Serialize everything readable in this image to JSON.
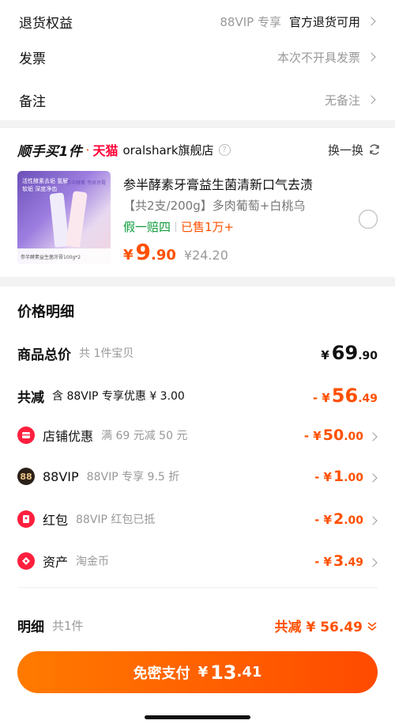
{
  "settings": {
    "refund": {
      "label": "退货权益",
      "value": "88VIP 专享",
      "value2": "官方退货可用"
    },
    "invoice": {
      "label": "发票",
      "value": "本次不开具发票"
    },
    "remark": {
      "label": "备注",
      "value": "无备注"
    }
  },
  "recommend": {
    "brand": "顺手买1件",
    "dot": "·",
    "platform": "天猫",
    "store": "oralshark旗舰店",
    "info_icon": "?",
    "swap_label": "换一换",
    "product": {
      "title": "参半酵素牙膏益生菌清新口气去渍",
      "spec": "【共2支/200g】多肉葡萄+白桃乌",
      "tag_guarantee": "假一赔四",
      "tag_sold": "已售1万+",
      "price_symbol": "¥",
      "price_int": "9",
      "price_dec": ".90",
      "original_price": "¥24.20",
      "image_text_1": "活性酵素去垢 氢解软垢 深度净齿",
      "image_text_2": "参半酵素 专研牙膏",
      "image_caption": "参半酵素益生菌牙膏100g*2",
      "image_brand": "参半"
    }
  },
  "price_detail": {
    "title": "价格明细",
    "goods_total": {
      "label": "商品总价",
      "desc": "共 1件宝贝",
      "symbol": "¥",
      "int": "69",
      "dec": ".90"
    },
    "reduction": {
      "label": "共减",
      "desc": "含 88VIP 专享优惠 ¥ 3.00",
      "prefix": "- ¥",
      "int": "56",
      "dec": ".49"
    },
    "items": [
      {
        "icon": "store-coupon-icon",
        "label": "店铺优惠",
        "desc": "满 69 元减 50 元",
        "prefix": "- ¥",
        "int": "50",
        "dec": ".00"
      },
      {
        "icon": "88vip-icon",
        "icon_text": "88",
        "label": "88VIP",
        "desc": "88VIP 专享 9.5 折",
        "prefix": "- ¥",
        "int": "1",
        "dec": ".00"
      },
      {
        "icon": "red-packet-icon",
        "label": "红包",
        "desc": "88VIP 红包已抵",
        "prefix": "- ¥",
        "int": "2",
        "dec": ".00"
      },
      {
        "icon": "assets-icon",
        "label": "资产",
        "desc": "淘金币",
        "prefix": "- ¥",
        "int": "3",
        "dec": ".49"
      }
    ]
  },
  "summary": {
    "label": "明细",
    "count": "共1件",
    "total_label": "共减 ¥ 56.49"
  },
  "pay_button": {
    "label": "免密支付",
    "symbol": "¥",
    "int": "13",
    "dec": ".41"
  },
  "colors": {
    "accent": "#ff5000",
    "tmall_red": "#ff0036",
    "green": "#0f9c3b"
  }
}
